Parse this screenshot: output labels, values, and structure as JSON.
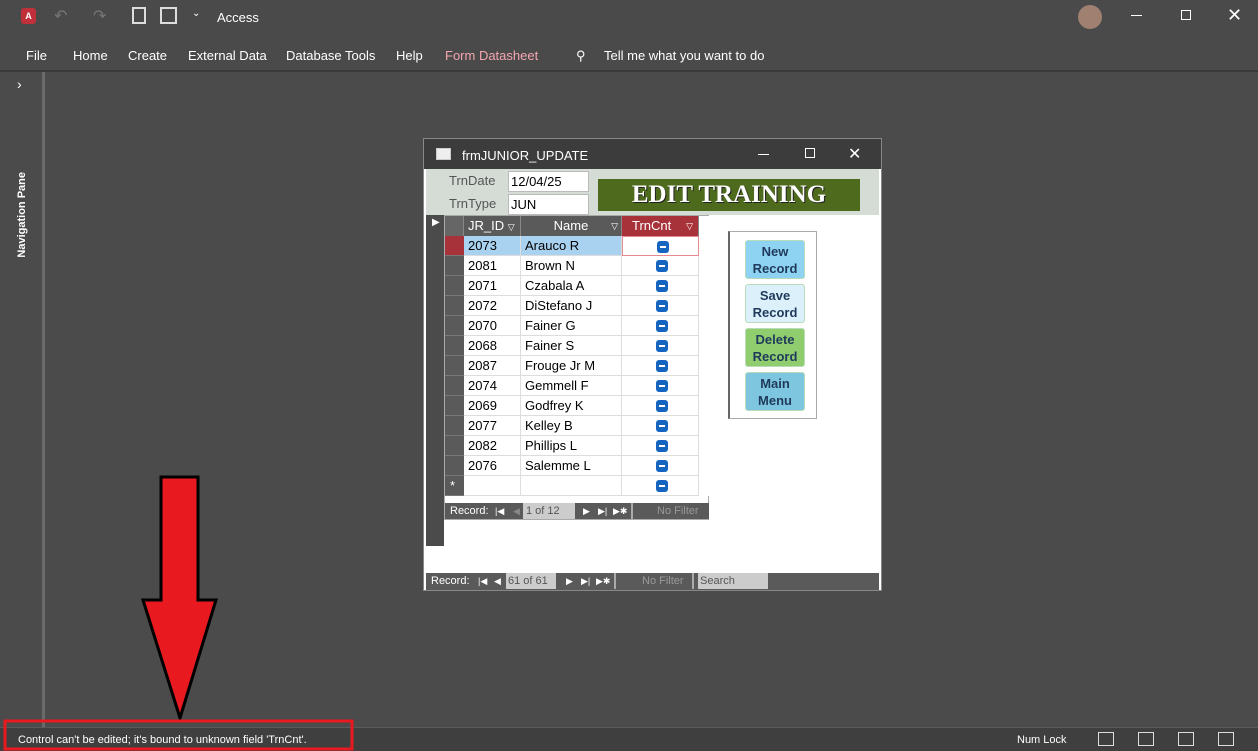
{
  "app": {
    "title": "Access",
    "icon": "access-logo-icon"
  },
  "ribbon": {
    "tabs": [
      "File",
      "Home",
      "Create",
      "External Data",
      "Database Tools",
      "Help",
      "Form Datasheet"
    ],
    "tell_me": "Tell me what you want to do"
  },
  "nav_pane": {
    "label": "Navigation Pane"
  },
  "form": {
    "title": "frmJUNIOR_UPDATE",
    "trn_date_label": "TrnDate",
    "trn_date": "12/04/25",
    "trn_type_label": "TrnType",
    "trn_type": "JUN",
    "banner": "EDIT TRAINING",
    "columns": [
      "JR_ID",
      "Name",
      "TrnCnt"
    ],
    "rows": [
      {
        "id": "2073",
        "name": "Arauco R"
      },
      {
        "id": "2081",
        "name": "Brown N"
      },
      {
        "id": "2071",
        "name": "Czabala A"
      },
      {
        "id": "2072",
        "name": "DiStefano J"
      },
      {
        "id": "2070",
        "name": "Fainer G"
      },
      {
        "id": "2068",
        "name": "Fainer S"
      },
      {
        "id": "2087",
        "name": "Frouge Jr M"
      },
      {
        "id": "2074",
        "name": "Gemmell F"
      },
      {
        "id": "2069",
        "name": "Godfrey K"
      },
      {
        "id": "2077",
        "name": "Kelley B"
      },
      {
        "id": "2082",
        "name": "Phillips L"
      },
      {
        "id": "2076",
        "name": "Salemme L"
      }
    ],
    "new_row_marker": "*",
    "sub_nav": {
      "label": "Record:",
      "position": "1 of 12",
      "filter": "No Filter"
    },
    "buttons": [
      {
        "label": "New Record",
        "color": "#8fd3f2"
      },
      {
        "label": "Save Record",
        "color": "#dcf0fb"
      },
      {
        "label": "Delete Record",
        "color": "#8fcd6e"
      },
      {
        "label": "Main Menu",
        "color": "#7ec6e0"
      }
    ],
    "main_nav": {
      "label": "Record:",
      "position": "61 of 61",
      "filter": "No Filter",
      "search": "Search"
    }
  },
  "status": {
    "message": "Control can't be edited; it's bound to unknown field 'TrnCnt'.",
    "num_lock": "Num Lock"
  }
}
